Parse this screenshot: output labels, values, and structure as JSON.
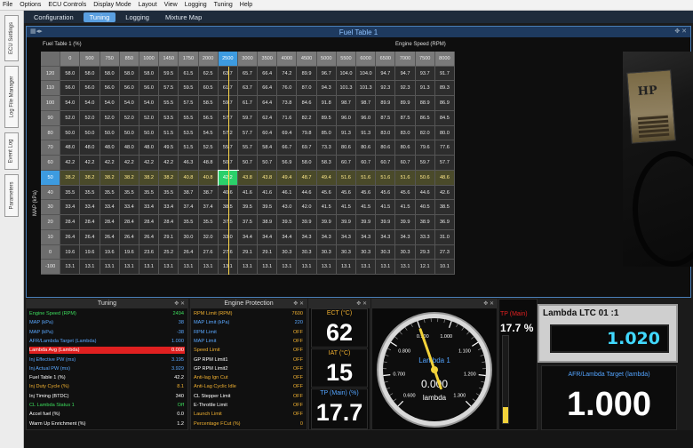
{
  "menu": [
    "File",
    "Options",
    "ECU Controls",
    "Display Mode",
    "Layout",
    "View",
    "Logging",
    "Tuning",
    "Help"
  ],
  "side_tabs": [
    "ECU Settings",
    "Log File Manager",
    "Event Log",
    "Parameters"
  ],
  "top_tabs": [
    {
      "label": "Configuration",
      "active": false
    },
    {
      "label": "Tuning",
      "active": true
    },
    {
      "label": "Logging",
      "active": false
    },
    {
      "label": "Mixture Map",
      "active": false
    }
  ],
  "fuel_table": {
    "title": "Fuel Table 1",
    "corner_label": "Fuel Table 1 (%)",
    "x_axis_label": "Engine Speed (RPM)",
    "y_axis_label": "MAP (kPa)",
    "col_headers": [
      "0",
      "500",
      "750",
      "850",
      "1000",
      "1450",
      "1750",
      "2000",
      "2500",
      "3000",
      "3500",
      "4000",
      "4500",
      "5000",
      "5500",
      "6000",
      "6500",
      "7000",
      "7500",
      "8000"
    ],
    "highlight_col": 8,
    "highlight_row": 7,
    "selected": [
      7,
      8
    ],
    "rows": [
      {
        "map": "120",
        "v": [
          "58.0",
          "58.0",
          "58.0",
          "58.0",
          "58.0",
          "59.5",
          "61.5",
          "62.5",
          "63.7",
          "65.7",
          "66.4",
          "74.2",
          "89.9",
          "96.7",
          "104.0",
          "104.0",
          "94.7",
          "94.7",
          "93.7",
          "91.7"
        ]
      },
      {
        "map": "110",
        "v": [
          "56.0",
          "56.0",
          "56.0",
          "56.0",
          "56.0",
          "57.5",
          "59.5",
          "60.5",
          "61.7",
          "63.7",
          "66.4",
          "76.0",
          "87.0",
          "94.3",
          "101.3",
          "101.3",
          "92.3",
          "92.3",
          "91.3",
          "89.3"
        ]
      },
      {
        "map": "100",
        "v": [
          "54.0",
          "54.0",
          "54.0",
          "54.0",
          "54.0",
          "55.5",
          "57.5",
          "58.5",
          "59.7",
          "61.7",
          "64.4",
          "73.8",
          "84.6",
          "91.8",
          "98.7",
          "98.7",
          "89.9",
          "89.9",
          "88.9",
          "86.9"
        ]
      },
      {
        "map": "90",
        "v": [
          "52.0",
          "52.0",
          "52.0",
          "52.0",
          "52.0",
          "53.5",
          "55.5",
          "56.5",
          "57.7",
          "59.7",
          "62.4",
          "71.6",
          "82.2",
          "89.5",
          "96.0",
          "96.0",
          "87.5",
          "87.5",
          "86.5",
          "84.5"
        ]
      },
      {
        "map": "80",
        "v": [
          "50.0",
          "50.0",
          "50.0",
          "50.0",
          "50.0",
          "51.5",
          "53.5",
          "54.5",
          "57.2",
          "57.7",
          "60.4",
          "69.4",
          "79.8",
          "85.0",
          "91.3",
          "91.3",
          "83.0",
          "83.0",
          "82.0",
          "80.0"
        ]
      },
      {
        "map": "70",
        "v": [
          "48.0",
          "48.0",
          "48.0",
          "48.0",
          "48.0",
          "49.5",
          "51.5",
          "52.5",
          "55.7",
          "55.7",
          "58.4",
          "66.7",
          "69.7",
          "73.3",
          "80.6",
          "80.6",
          "80.6",
          "80.6",
          "79.6",
          "77.6"
        ]
      },
      {
        "map": "60",
        "v": [
          "42.2",
          "42.2",
          "42.2",
          "42.2",
          "42.2",
          "42.2",
          "46.3",
          "48.8",
          "50.7",
          "50.7",
          "50.7",
          "56.9",
          "58.0",
          "58.3",
          "60.7",
          "60.7",
          "60.7",
          "60.7",
          "59.7",
          "57.7"
        ]
      },
      {
        "map": "50",
        "v": [
          "38.2",
          "38.2",
          "38.2",
          "38.2",
          "38.2",
          "38.2",
          "40.8",
          "40.8",
          "42.2",
          "43.8",
          "43.8",
          "49.4",
          "48.7",
          "49.4",
          "51.6",
          "51.6",
          "51.6",
          "51.6",
          "50.6",
          "48.6"
        ]
      },
      {
        "map": "40",
        "v": [
          "35.5",
          "35.5",
          "35.5",
          "35.5",
          "35.5",
          "35.5",
          "38.7",
          "38.7",
          "40.6",
          "41.6",
          "41.6",
          "46.1",
          "44.6",
          "45.6",
          "45.6",
          "45.6",
          "45.6",
          "45.6",
          "44.6",
          "42.6"
        ]
      },
      {
        "map": "30",
        "v": [
          "33.4",
          "33.4",
          "33.4",
          "33.4",
          "33.4",
          "33.4",
          "37.4",
          "37.4",
          "38.5",
          "39.5",
          "39.5",
          "43.0",
          "42.0",
          "41.5",
          "41.5",
          "41.5",
          "41.5",
          "41.5",
          "40.5",
          "38.5"
        ]
      },
      {
        "map": "20",
        "v": [
          "28.4",
          "28.4",
          "28.4",
          "28.4",
          "28.4",
          "28.4",
          "35.5",
          "35.5",
          "37.5",
          "37.5",
          "38.9",
          "39.5",
          "39.9",
          "39.9",
          "39.9",
          "39.9",
          "39.9",
          "39.9",
          "38.9",
          "36.9"
        ]
      },
      {
        "map": "10",
        "v": [
          "26.4",
          "26.4",
          "26.4",
          "26.4",
          "26.4",
          "29.1",
          "30.0",
          "32.0",
          "33.0",
          "34.4",
          "34.4",
          "34.4",
          "34.3",
          "34.3",
          "34.3",
          "34.3",
          "34.3",
          "34.3",
          "33.3",
          "31.0"
        ]
      },
      {
        "map": "0",
        "v": [
          "19.6",
          "19.6",
          "19.6",
          "19.6",
          "23.6",
          "25.2",
          "26.4",
          "27.6",
          "27.6",
          "29.1",
          "29.1",
          "30.3",
          "30.3",
          "30.3",
          "30.3",
          "30.3",
          "30.3",
          "30.3",
          "29.3",
          "27.3"
        ]
      },
      {
        "map": "-100",
        "v": [
          "13.1",
          "13.1",
          "13.1",
          "13.1",
          "13.1",
          "13.1",
          "13.1",
          "13.1",
          "13.1",
          "13.1",
          "13.1",
          "13.1",
          "13.1",
          "13.1",
          "13.1",
          "13.1",
          "13.1",
          "13.1",
          "12.1",
          "10.1"
        ]
      }
    ]
  },
  "tuning_panel": {
    "title": "Tuning",
    "rows": [
      {
        "label": "Engine Speed (RPM)",
        "value": "2494",
        "color": "#3cdc5c",
        "vcolor": "#3cdc5c"
      },
      {
        "label": "MAP (kPa)",
        "value": "38",
        "color": "#5aa8ff",
        "vcolor": "#5aa8ff"
      },
      {
        "label": "MAP (kPa)",
        "value": "-38",
        "color": "#5aa8ff",
        "vcolor": "#5aa8ff"
      },
      {
        "label": "AFR/Lambda Target (Lambda)",
        "value": "1.000",
        "color": "#5aa8ff",
        "vcolor": "#5aa8ff"
      },
      {
        "label": "Lambda Avg (Lambda)",
        "value": "0.000",
        "color": "#ffffff",
        "vcolor": "#ffffff",
        "bg": "#e02020"
      },
      {
        "label": "Inj Effective PW (ms)",
        "value": "3.195",
        "color": "#5aa8ff",
        "vcolor": "#5aa8ff"
      },
      {
        "label": "Inj Actual PW (ms)",
        "value": "3.929",
        "color": "#5aa8ff",
        "vcolor": "#5aa8ff"
      },
      {
        "label": "Fuel Table 1 (%)",
        "value": "42.2",
        "color": "#ffffff",
        "vcolor": "#ffffff"
      },
      {
        "label": "Inj Duty Cycle (%)",
        "value": "8.1",
        "color": "#f0b030",
        "vcolor": "#f0b030"
      },
      {
        "label": "Inj Timing (BTDC)",
        "value": "340",
        "color": "#ffffff",
        "vcolor": "#ffffff"
      },
      {
        "label": "CL Lambda Status 1",
        "value": "Off",
        "color": "#3cdc5c",
        "vcolor": "#3cdc5c"
      },
      {
        "label": "Accel fuel (%)",
        "value": "0.0",
        "color": "#ffffff",
        "vcolor": "#ffffff"
      },
      {
        "label": "Warm Up Enrichment (%)",
        "value": "1.2",
        "color": "#ffffff",
        "vcolor": "#ffffff"
      }
    ]
  },
  "protection_panel": {
    "title": "Engine Protection",
    "rows": [
      {
        "label": "RPM Limit (RPM)",
        "value": "7600",
        "color": "#f0b030",
        "vcolor": "#f0b030"
      },
      {
        "label": "MAP Limit (kPa)",
        "value": "220",
        "color": "#5aa8ff",
        "vcolor": "#5aa8ff"
      },
      {
        "label": "RPM Limit",
        "value": "OFF",
        "color": "#5aa8ff",
        "vcolor": "#f0b030"
      },
      {
        "label": "MAP Limit",
        "value": "OFF",
        "color": "#5aa8ff",
        "vcolor": "#f0b030"
      },
      {
        "label": "Speed Limit",
        "value": "OFF",
        "color": "#f0b030",
        "vcolor": "#f0b030"
      },
      {
        "label": "GP RPM Limit1",
        "value": "OFF",
        "color": "#ffffff",
        "vcolor": "#f0b030"
      },
      {
        "label": "GP RPM Limit2",
        "value": "OFF",
        "color": "#ffffff",
        "vcolor": "#f0b030"
      },
      {
        "label": "Anti-lag Ign Cut",
        "value": "OFF",
        "color": "#f0b030",
        "vcolor": "#f0b030"
      },
      {
        "label": "Anti-Lag Cyclic Idle",
        "value": "OFF",
        "color": "#f0b030",
        "vcolor": "#f0b030"
      },
      {
        "label": "CL Stepper Limit",
        "value": "OFF",
        "color": "#ffffff",
        "vcolor": "#f0b030"
      },
      {
        "label": "E-Throttle Limit",
        "value": "OFF",
        "color": "#ffffff",
        "vcolor": "#f0b030"
      },
      {
        "label": "Launch Limit",
        "value": "OFF",
        "color": "#f0b030",
        "vcolor": "#f0b030"
      },
      {
        "label": "Percentage FCut (%)",
        "value": "0",
        "color": "#f0b030",
        "vcolor": "#f0b030"
      }
    ]
  },
  "gauges": {
    "ect": {
      "label": "ECT (°C)",
      "value": "62"
    },
    "iat": {
      "label": "IAT (°C)",
      "value": "15"
    },
    "tp": {
      "label": "TP (Main) (%)",
      "value": "17.7"
    },
    "tp_bar": {
      "label": "TP (Main)",
      "value": "17.7 %",
      "fraction": 0.18
    }
  },
  "dial": {
    "label": "Lambda 1",
    "value": "0.000",
    "unit": "lambda",
    "ticks": [
      "0.600",
      "0.700",
      "0.800",
      "0.900",
      "1.000",
      "1.100",
      "1.200",
      "1.300"
    ],
    "needle_value": 0.9,
    "min": 0.6,
    "max": 1.3
  },
  "lambda_ltc": {
    "title": "Lambda LTC 01 :1",
    "value": "1.020"
  },
  "afr_target": {
    "label": "AFR/Lambda Target (lambda)",
    "value": "1.000"
  },
  "video": {
    "logo": "HP",
    "sub": "ACADEMY"
  }
}
